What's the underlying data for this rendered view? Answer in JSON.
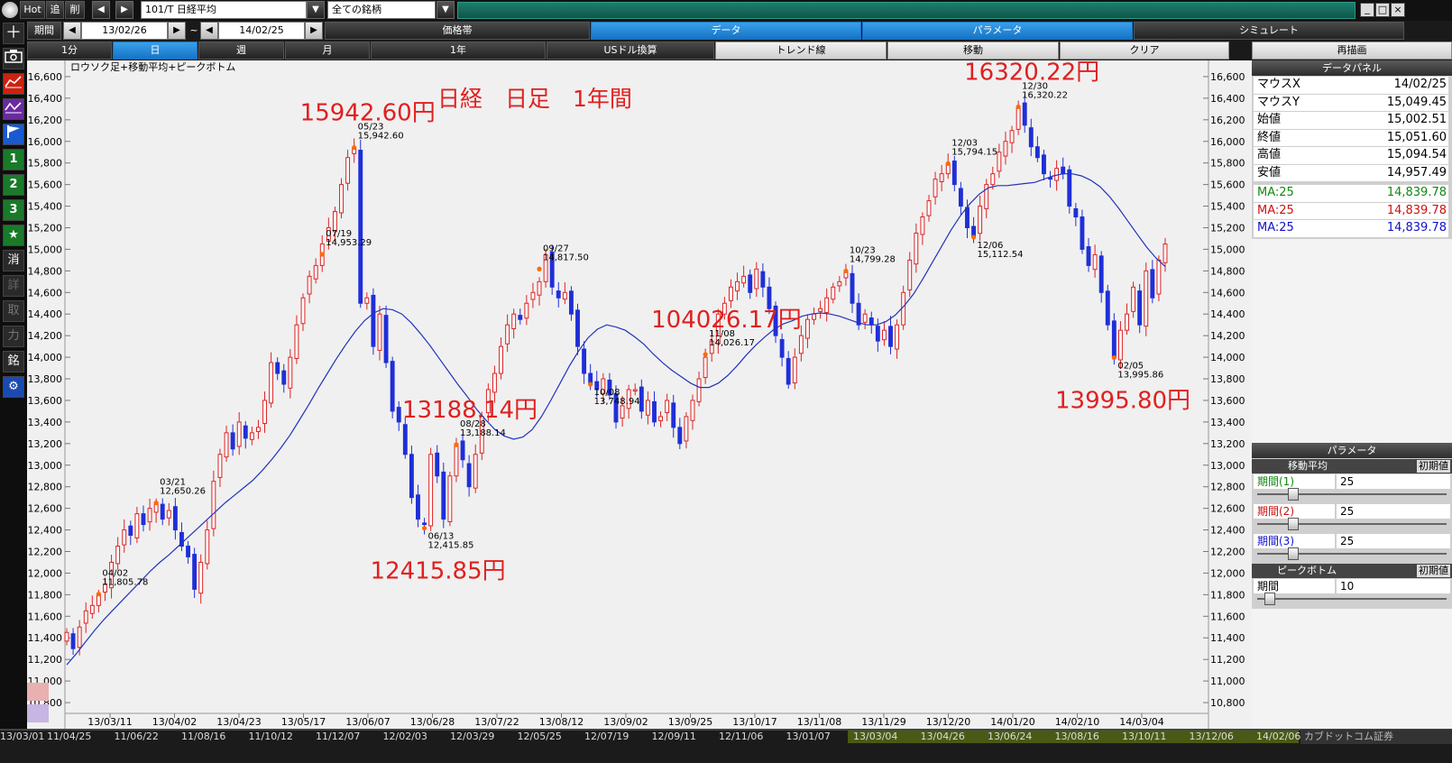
{
  "toolbar": {
    "hot": "Hot",
    "add": "追",
    "del": "削",
    "symbol": "101/T 日経平均",
    "market": "全ての銘柄",
    "period_label": "期間",
    "date_from": "13/02/26",
    "tilde": "~",
    "date_to": "14/02/25",
    "tabs_row1": [
      "価格帯",
      "データ",
      "パラメータ",
      "シミュレート"
    ],
    "tabs_row2": [
      "1分",
      "日",
      "週",
      "月",
      "1年",
      "USドル換算",
      "トレンド線",
      "移動",
      "クリア",
      "再描画"
    ],
    "window_controls": [
      "minimize-icon",
      "maximize-icon",
      "close-icon"
    ]
  },
  "sidebar": {
    "buttons": [
      "plus-icon",
      "camera-icon",
      "candle-chart-icon",
      "line-chart-icon",
      "flag-icon",
      "1",
      "2",
      "3",
      "★",
      "消",
      "詳",
      "取",
      "力",
      "銘",
      "gear-icon"
    ]
  },
  "chart_data": {
    "type": "candlestick",
    "title": "ロウソク足+移動平均+ピークボトム",
    "annotation_title": "日経　日足　1年間",
    "ylim": [
      10700,
      16750
    ],
    "y_ticks": [
      10800,
      11000,
      11200,
      11400,
      11600,
      11800,
      12000,
      12200,
      12400,
      12600,
      12800,
      13000,
      13200,
      13400,
      13600,
      13800,
      14000,
      14200,
      14400,
      14600,
      14800,
      15000,
      15200,
      15400,
      15600,
      15800,
      16000,
      16200,
      16400,
      16600
    ],
    "y_tick_labels": [
      "10,800",
      "11,000",
      "11,200",
      "11,400",
      "11,600",
      "11,800",
      "12,000",
      "12,200",
      "12,400",
      "12,600",
      "12,800",
      "13,000",
      "13,200",
      "13,400",
      "13,600",
      "13,800",
      "14,000",
      "14,200",
      "14,400",
      "14,600",
      "14,800",
      "15,000",
      "15,200",
      "15,400",
      "15,600",
      "15,800",
      "16,000",
      "16,200",
      "16,400",
      "16,600"
    ],
    "x_tick_labels": [
      "13/03/11",
      "13/04/02",
      "13/04/23",
      "13/05/17",
      "13/06/07",
      "13/06/28",
      "13/07/22",
      "13/08/12",
      "13/09/02",
      "13/09/25",
      "13/10/17",
      "13/11/08",
      "13/11/29",
      "13/12/20",
      "14/01/20",
      "14/02/10",
      "14/03/04"
    ],
    "up_color": "#dd2222",
    "down_color": "#1f2fd8",
    "ma_color": "#2233bb",
    "peak_color": "#ff6a00",
    "closes": [
      11450,
      11300,
      11500,
      11650,
      11700,
      11800,
      11900,
      12100,
      12250,
      12400,
      12350,
      12550,
      12450,
      12600,
      12650,
      12500,
      12580,
      12400,
      12250,
      12150,
      11850,
      12100,
      12400,
      12850,
      13100,
      13300,
      13150,
      13400,
      13250,
      13300,
      13350,
      13600,
      13950,
      13850,
      13750,
      14000,
      14300,
      14550,
      14750,
      14850,
      15050,
      15200,
      15350,
      15600,
      15850,
      15942,
      14500,
      14550,
      14100,
      14400,
      13950,
      13500,
      13400,
      13100,
      12700,
      12500,
      12450,
      13100,
      12900,
      12500,
      12900,
      13200,
      13050,
      12800,
      13100,
      13450,
      13700,
      13850,
      14100,
      14300,
      14400,
      14350,
      14500,
      14600,
      14700,
      14950,
      14650,
      14550,
      14600,
      14400,
      14100,
      13850,
      13750,
      13700,
      13800,
      13650,
      13400,
      13550,
      13700,
      13700,
      13500,
      13600,
      13400,
      13450,
      13600,
      13350,
      13200,
      13450,
      13600,
      13800,
      14000,
      14150,
      14400,
      14500,
      14650,
      14700,
      14750,
      14600,
      14817,
      14650,
      14450,
      14200,
      14000,
      13750,
      14000,
      14200,
      14350,
      14400,
      14450,
      14550,
      14650,
      14700,
      14799,
      14500,
      14300,
      14400,
      14300,
      14150,
      14250,
      14100,
      14300,
      14600,
      14900,
      15150,
      15300,
      15450,
      15650,
      15700,
      15794,
      15600,
      15400,
      15200,
      15112,
      15400,
      15600,
      15700,
      15900,
      16000,
      16100,
      16320,
      16150,
      15950,
      15850,
      15700,
      15650,
      15750,
      15700,
      15400,
      15300,
      15000,
      14850,
      14950,
      14600,
      14300,
      14000,
      14250,
      14400,
      14650,
      14300,
      14800,
      14550,
      14900,
      15049
    ],
    "ma": [
      11150,
      11250,
      11360,
      11470,
      11570,
      11660,
      11750,
      11840,
      11930,
      12020,
      12100,
      12170,
      12250,
      12330,
      12410,
      12490,
      12570,
      12650,
      12720,
      12790,
      12860,
      12950,
      13050,
      13160,
      13280,
      13420,
      13560,
      13710,
      13850,
      13990,
      14120,
      14240,
      14340,
      14410,
      14450,
      14440,
      14400,
      14320,
      14220,
      14110,
      13990,
      13870,
      13750,
      13640,
      13520,
      13420,
      13330,
      13270,
      13240,
      13260,
      13330,
      13450,
      13600,
      13760,
      13920,
      14060,
      14180,
      14260,
      14300,
      14280,
      14250,
      14190,
      14120,
      14030,
      13950,
      13880,
      13820,
      13760,
      13720,
      13720,
      13760,
      13830,
      13920,
      14020,
      14110,
      14190,
      14260,
      14310,
      14340,
      14380,
      14400,
      14410,
      14400,
      14380,
      14350,
      14320,
      14300,
      14300,
      14330,
      14390,
      14480,
      14590,
      14730,
      14880,
      15030,
      15180,
      15310,
      15420,
      15510,
      15570,
      15590,
      15590,
      15600,
      15610,
      15620,
      15650,
      15680,
      15700,
      15700,
      15680,
      15640,
      15580,
      15490,
      15380,
      15260,
      15140,
      15020,
      14920,
      14840
    ],
    "peaks": [
      {
        "date": "03/21",
        "value": "12,650.26",
        "big": ""
      },
      {
        "date": "04/02",
        "value": "11,805.78",
        "big": ""
      },
      {
        "date": "05/23",
        "value": "15,942.60",
        "big": "15942.60円"
      },
      {
        "date": "06/13",
        "value": "12,415.85",
        "big": "12415.85円"
      },
      {
        "date": "07/19",
        "value": "14,953.29",
        "big": ""
      },
      {
        "date": "08/28",
        "value": "13,188.14",
        "big": "13188.14円"
      },
      {
        "date": "09/27",
        "value": "14,817.50",
        "big": ""
      },
      {
        "date": "10/08",
        "value": "13,748.94",
        "big": ""
      },
      {
        "date": "10/23",
        "value": "14,799.28",
        "big": ""
      },
      {
        "date": "11/08",
        "value": "14,026.17",
        "big": "104026.17円"
      },
      {
        "date": "12/03",
        "value": "15,794.15",
        "big": ""
      },
      {
        "date": "12/06",
        "value": "15,112.54",
        "big": ""
      },
      {
        "date": "12/30",
        "value": "16,320.22",
        "big": "16320.22円"
      },
      {
        "date": "02/05",
        "value": "13,995.86",
        "big": "13995.80円"
      }
    ]
  },
  "data_panel": {
    "header": "データパネル",
    "rows": [
      {
        "k": "マウスX",
        "v": "14/02/25"
      },
      {
        "k": "マウスY",
        "v": "15,049.45"
      },
      {
        "k": "始値",
        "v": "15,002.51"
      },
      {
        "k": "終値",
        "v": "15,051.60"
      },
      {
        "k": "高値",
        "v": "15,094.54"
      },
      {
        "k": "安値",
        "v": "14,957.49"
      },
      {
        "k": "MA:25",
        "v": "14,839.78",
        "color": "#118811"
      },
      {
        "k": "MA:25",
        "v": "14,839.78",
        "color": "#cc1111"
      },
      {
        "k": "MA:25",
        "v": "14,839.78",
        "color": "#1111cc"
      }
    ]
  },
  "param_panel": {
    "header": "パラメータ",
    "ma_header": "移動平均",
    "init_label": "初期値",
    "periods": [
      {
        "label": "期間(1)",
        "value": "25",
        "color": "#118811",
        "level": 0.17
      },
      {
        "label": "期間(2)",
        "value": "25",
        "color": "#cc1111",
        "level": 0.17
      },
      {
        "label": "期間(3)",
        "value": "25",
        "color": "#1111cc",
        "level": 0.17
      }
    ],
    "pb_header": "ピークボトム",
    "pb_init": "初期値",
    "pb_period_label": "期間",
    "pb_period_value": "10",
    "pb_level": 0.04
  },
  "bottom_timeline": [
    "13/03/01",
    "11/04/25",
    "11/06/22",
    "11/08/16",
    "11/10/12",
    "11/12/07",
    "12/02/03",
    "12/03/29",
    "12/05/25",
    "12/07/19",
    "12/09/11",
    "12/11/06",
    "13/01/07",
    "13/03/04",
    "13/04/26",
    "13/06/24",
    "13/08/16",
    "13/10/11",
    "13/12/06",
    "14/02/06"
  ],
  "brand": "カブドットコム証券"
}
